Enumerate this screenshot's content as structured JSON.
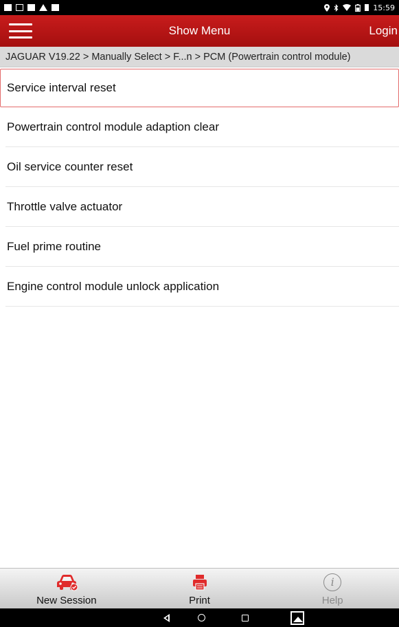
{
  "status_bar": {
    "time": "15:59",
    "left_icons": [
      "notification-icon",
      "sim-icon",
      "square-icon",
      "warning-icon",
      "notification-icon"
    ],
    "right_icons": [
      "location-icon",
      "bluetooth-icon",
      "wifi-icon",
      "battery-icon"
    ]
  },
  "app_bar": {
    "menu_icon": "hamburger-icon",
    "title": "Show Menu",
    "login_label": "Login"
  },
  "breadcrumb": {
    "text": "JAGUAR V19.22 > Manually Select > F...n > PCM (Powertrain control module)"
  },
  "menu": {
    "items": [
      {
        "label": "Service interval reset",
        "selected": true
      },
      {
        "label": "Powertrain control module adaption clear",
        "selected": false
      },
      {
        "label": "Oil service counter reset",
        "selected": false
      },
      {
        "label": "Throttle valve actuator",
        "selected": false
      },
      {
        "label": "Fuel prime routine",
        "selected": false
      },
      {
        "label": "Engine control module unlock application",
        "selected": false
      }
    ]
  },
  "toolbar": {
    "new_session_label": "New Session",
    "print_label": "Print",
    "help_label": "Help",
    "help_glyph": "i",
    "accent_color": "#e02b2b",
    "disabled_color": "#8a8a8a"
  },
  "nav_bar": {
    "buttons": [
      "back-icon",
      "home-icon",
      "recent-apps-icon",
      "gallery-icon"
    ]
  }
}
